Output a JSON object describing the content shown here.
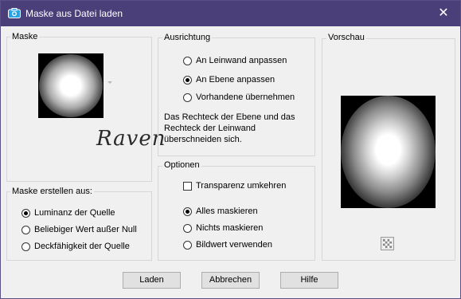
{
  "window": {
    "title": "Maske aus Datei laden",
    "close_glyph": "✕",
    "title_icon": "camera-icon"
  },
  "mask_group": {
    "label": "Maske",
    "watermark": "Raven"
  },
  "create_group": {
    "label": "Maske erstellen aus:",
    "options": [
      {
        "label": "Luminanz der Quelle",
        "checked": true
      },
      {
        "label": "Beliebiger Wert außer Null",
        "checked": false
      },
      {
        "label": "Deckfähigkeit der Quelle",
        "checked": false
      }
    ]
  },
  "alignment_group": {
    "label": "Ausrichtung",
    "options": [
      {
        "label": "An Leinwand anpassen",
        "checked": false
      },
      {
        "label": "An Ebene anpassen",
        "checked": true
      },
      {
        "label": "Vorhandene übernehmen",
        "checked": false
      }
    ],
    "note": [
      "Das Rechteck der Ebene und das",
      "Rechteck der Leinwand",
      "überschneiden sich."
    ]
  },
  "options_group": {
    "label": "Optionen",
    "invert_transparency": {
      "label": "Transparenz umkehren",
      "checked": false
    },
    "options": [
      {
        "label": "Alles maskieren",
        "checked": true
      },
      {
        "label": "Nichts maskieren",
        "checked": false
      },
      {
        "label": "Bildwert verwenden",
        "checked": false
      }
    ]
  },
  "preview_group": {
    "label": "Vorschau",
    "toggle_icon": "checkerboard-icon"
  },
  "buttons": {
    "load": "Laden",
    "cancel": "Abbrechen",
    "help": "Hilfe"
  },
  "colors": {
    "titlebar": "#4a3f78",
    "dialog_bg": "#f0f0f0",
    "button_bg": "#e1e1e1"
  }
}
